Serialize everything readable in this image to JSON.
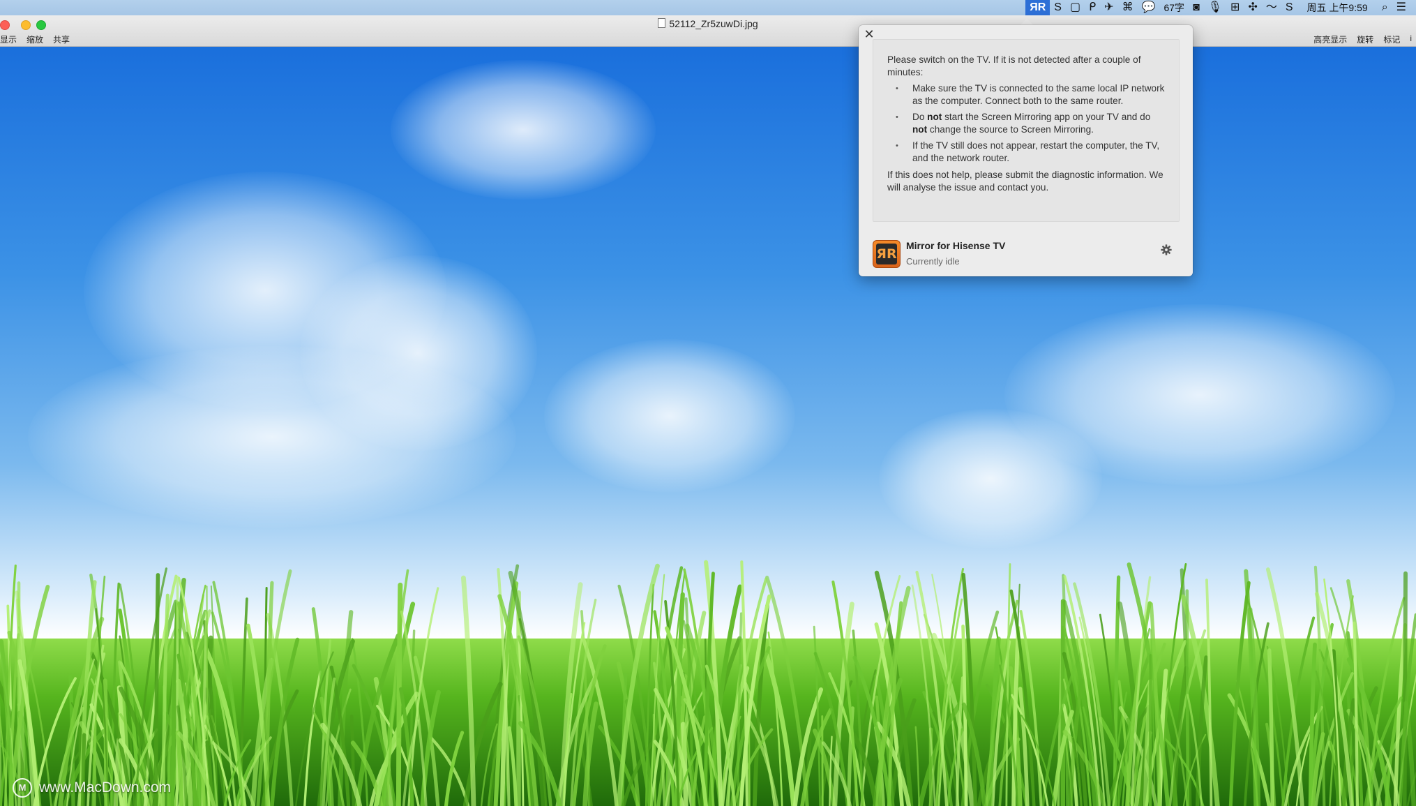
{
  "menubar": {
    "items": [
      {
        "glyph": "ЯR",
        "icon": "mirror-app-icon",
        "active": true
      },
      {
        "glyph": "S",
        "icon": "s-app-icon"
      },
      {
        "glyph": "▢",
        "icon": "square-app-icon"
      },
      {
        "glyph": "ᑭ",
        "icon": "p-app-icon"
      },
      {
        "glyph": "✈",
        "icon": "paper-plane-icon"
      },
      {
        "glyph": "⌘",
        "icon": "grid-app-icon"
      },
      {
        "glyph": "💬",
        "icon": "chat-icon"
      }
    ],
    "word_count": "67字",
    "tray_items": [
      {
        "glyph": "◙",
        "icon": "camera-app-icon"
      },
      {
        "glyph": "🎙",
        "icon": "microphone-icon"
      },
      {
        "glyph": "⊞",
        "icon": "table-app-icon"
      },
      {
        "glyph": "✣",
        "icon": "move-icon"
      },
      {
        "glyph": "〜",
        "icon": "wifi-icon"
      },
      {
        "glyph": "S",
        "icon": "sync-app-icon"
      }
    ],
    "clock": "周五 上午9:59",
    "search_glyph": "⌕",
    "list_glyph": "☰"
  },
  "window": {
    "title": "52112_Zr5zuwDi.jpg",
    "toolbar_left": [
      "显示",
      "缩放",
      "共享"
    ],
    "toolbar_right": [
      "高亮显示",
      "旋转",
      "标记",
      "i"
    ]
  },
  "popover": {
    "close_glyph": "✕",
    "intro": "Please switch on the TV. If it is not detected after a couple of minutes:",
    "bullet1": "Make sure the TV is connected to the same local IP network as the computer. Connect both to the same router.",
    "bullet2_a": "Do ",
    "bullet2_bold1": "not",
    "bullet2_b": " start the Screen Mirroring app on your TV and do ",
    "bullet2_bold2": "not",
    "bullet2_c": " change the source to Screen Mirroring.",
    "bullet3": "If the TV still does not appear, restart the computer, the TV, and the network router.",
    "outro": "If this does not help, please submit the diagnostic information. We will analyse the issue and contact you.",
    "app_icon_text": "ЯR",
    "app_name": "Mirror for Hisense TV",
    "app_status": "Currently idle"
  },
  "watermark": {
    "logo": "M",
    "text": "www.MacDown.com"
  }
}
